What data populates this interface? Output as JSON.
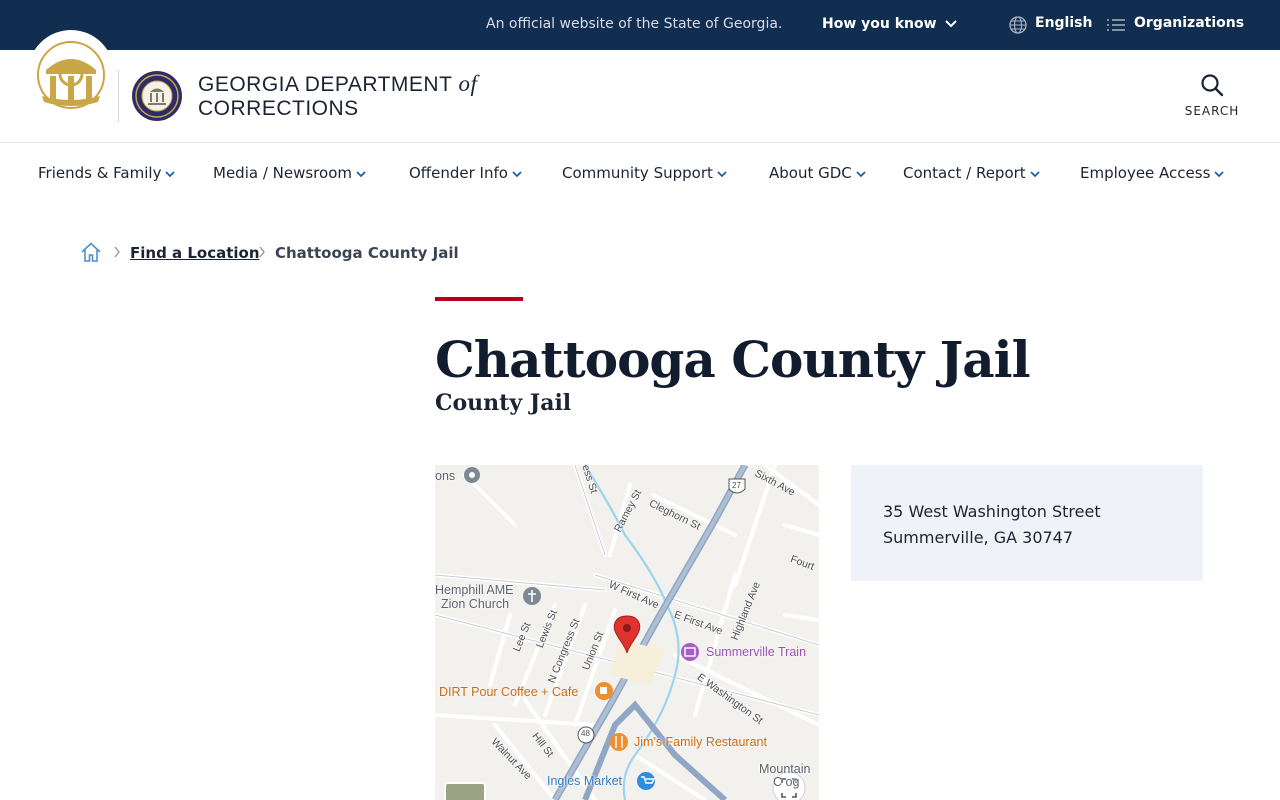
{
  "topbar": {
    "official_text": "An official website of the State of Georgia.",
    "how_you_know": "How you know",
    "language": "English",
    "organizations": "Organizations",
    "background_color": "#112e51"
  },
  "header": {
    "agency_line1": "GEORGIA DEPARTMENT",
    "agency_of": "of",
    "agency_line2": "CORRECTIONS",
    "search_label": "SEARCH",
    "seal_color": "#c9a646",
    "gdc_seal_color": "#2e2b6b"
  },
  "nav": {
    "items": [
      {
        "label": "Friends & Family"
      },
      {
        "label": "Media / Newsroom"
      },
      {
        "label": "Offender Info"
      },
      {
        "label": "Community Support"
      },
      {
        "label": "About GDC"
      },
      {
        "label": "Contact / Report"
      },
      {
        "label": "Employee Access"
      }
    ],
    "chevron_color": "#1d5fa8"
  },
  "breadcrumb": {
    "home_icon": "home-icon",
    "link": "Find a Location",
    "current": "Chattooga County Jail"
  },
  "page": {
    "title": "Chattooga County Jail",
    "subtitle": "County Jail",
    "accent_color": "#b3001b"
  },
  "map": {
    "pois": {
      "ons": "ons",
      "hemphill_1": "Hemphill AME",
      "hemphill_2": "Zion Church",
      "train": "Summerville Train",
      "coffee": "DIRT Pour Coffee + Cafe",
      "jims": "Jim's Family Restaurant",
      "ingles": "Ingles Market",
      "mountain_1": "Mountain",
      "mountain_2": "C   og"
    },
    "streets": {
      "ess": "ess St",
      "ramey": "Ramey St",
      "cleghorn": "Cleghorn St",
      "sixth": "Sixth Ave",
      "fourth": "Fourt",
      "w_first": "W First Ave",
      "e_first": "E First Ave",
      "highland": "Highland Ave",
      "lee": "Lee St",
      "lewis": "Lewis St",
      "n_congress": "N Congress St",
      "union": "Union St",
      "e_washington": "E Washington St",
      "hill": "Hill St",
      "walnut": "Walnut Ave",
      "route_27": "27",
      "route_48": "48"
    }
  },
  "address": {
    "street": "35 West Washington Street",
    "city_state_zip": "Summerville, GA 30747"
  }
}
